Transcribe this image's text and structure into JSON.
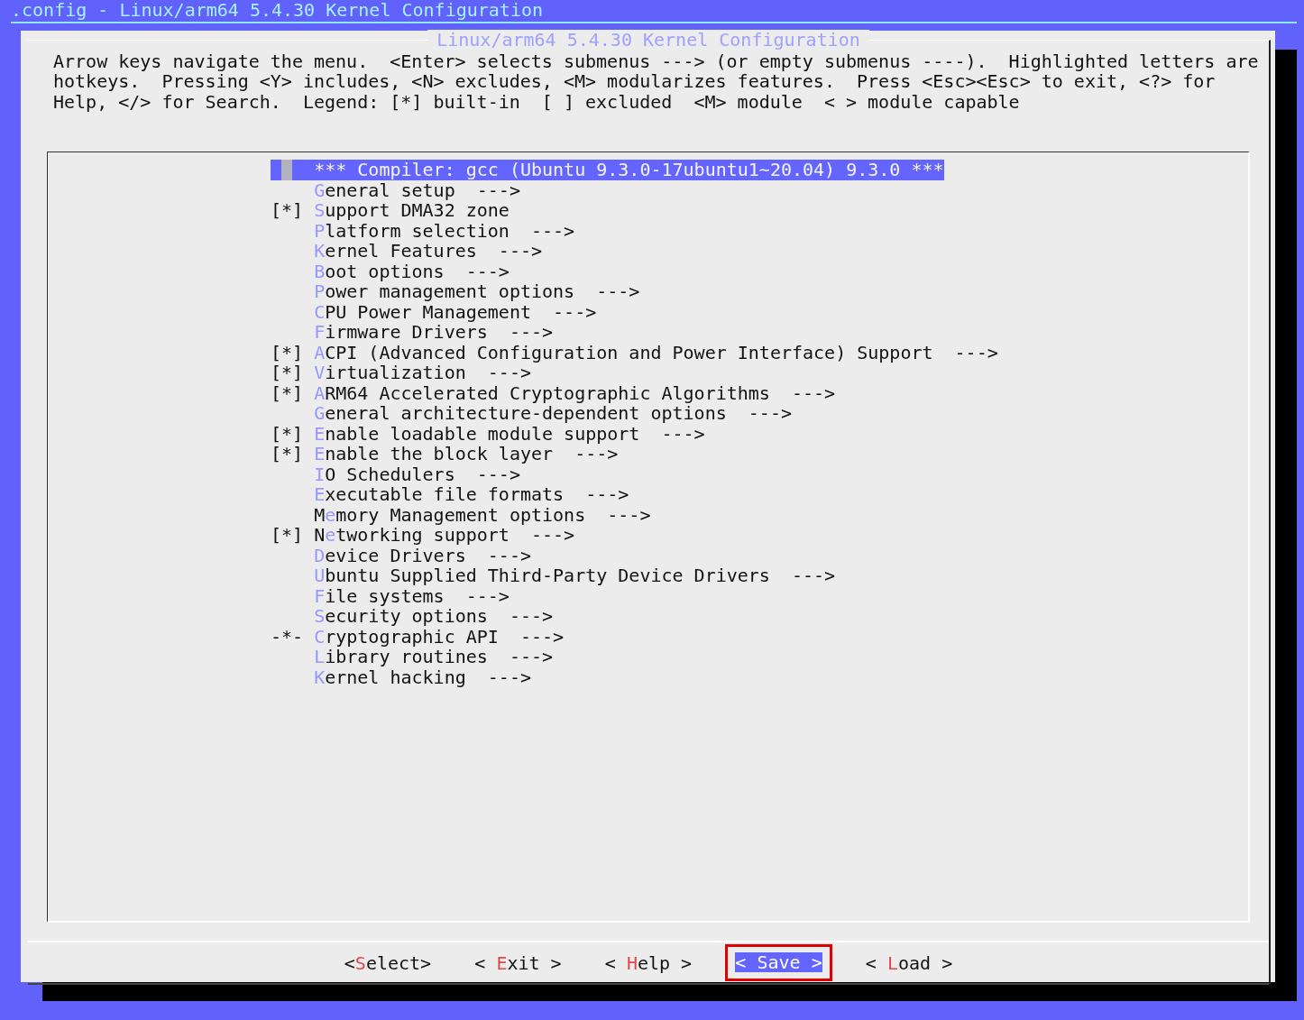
{
  "terminal_title": ".config - Linux/arm64 5.4.30 Kernel Configuration",
  "dialog": {
    "title": "Linux/arm64 5.4.30 Kernel Configuration",
    "help_text": "Arrow keys navigate the menu.  <Enter> selects submenus ---> (or empty submenus ----).  Highlighted letters are hotkeys.  Pressing <Y> includes, <N> excludes, <M> modularizes features.  Press <Esc><Esc> to exit, <?> for Help, </> for Search.  Legend: [*] built-in  [ ] excluded  <M> module  < > module capable",
    "menu_items": [
      {
        "lead": "*** Compiler: gcc (Ubuntu 9.3.0-17ubuntu1~20.04) 9.3.0 ***",
        "selected": true
      },
      {
        "hotkey": "G",
        "rest": "eneral setup  --->",
        "selected": false
      },
      {
        "marker": "[*]",
        "hotkey": "S",
        "rest": "upport DMA32 zone",
        "selected": false
      },
      {
        "hotkey": "P",
        "rest": "latform selection  --->",
        "selected": false
      },
      {
        "hotkey": "K",
        "rest": "ernel Features  --->",
        "selected": false
      },
      {
        "hotkey": "B",
        "rest": "oot options  --->",
        "selected": false
      },
      {
        "hotkey": "P",
        "rest": "ower management options  --->",
        "selected": false
      },
      {
        "hotkey": "C",
        "rest": "PU Power Management  --->",
        "selected": false
      },
      {
        "hotkey": "F",
        "rest": "irmware Drivers  --->",
        "selected": false
      },
      {
        "marker": "[*]",
        "hotkey": "A",
        "rest": "CPI (Advanced Configuration and Power Interface) Support  --->",
        "selected": false
      },
      {
        "marker": "[*]",
        "hotkey": "V",
        "rest": "irtualization  --->",
        "selected": false
      },
      {
        "marker": "[*]",
        "hotkey": "A",
        "rest": "RM64 Accelerated Cryptographic Algorithms  --->",
        "selected": false
      },
      {
        "hotkey": "G",
        "rest": "eneral architecture-dependent options  --->",
        "selected": false
      },
      {
        "marker": "[*]",
        "hotkey": "E",
        "rest": "nable loadable module support  --->",
        "selected": false
      },
      {
        "marker": "[*]",
        "hotkey": "E",
        "rest": "nable the block layer  --->",
        "selected": false
      },
      {
        "hotkey": "I",
        "rest": "O Schedulers  --->",
        "selected": false
      },
      {
        "hotkey": "E",
        "rest": "xecutable file formats  --->",
        "selected": false
      },
      {
        "lead": "M",
        "hotkey": "e",
        "rest": "mory Management options  --->",
        "selected": false
      },
      {
        "marker": "[*]",
        "lead": "N",
        "hotkey": "e",
        "rest": "tworking support  --->",
        "selected": false
      },
      {
        "hotkey": "D",
        "rest": "evice Drivers  --->",
        "selected": false
      },
      {
        "hotkey": "U",
        "rest": "buntu Supplied Third-Party Device Drivers  --->",
        "selected": false
      },
      {
        "hotkey": "F",
        "rest": "ile systems  --->",
        "selected": false
      },
      {
        "hotkey": "S",
        "rest": "ecurity options  --->",
        "selected": false
      },
      {
        "marker": "-*-",
        "hotkey": "C",
        "rest": "ryptographic API  --->",
        "selected": false
      },
      {
        "hotkey": "L",
        "rest": "ibrary routines  --->",
        "selected": false
      },
      {
        "hotkey": "K",
        "rest": "ernel hacking  --->",
        "selected": false
      }
    ],
    "buttons": [
      {
        "lead": "<",
        "hotkey": "S",
        "rest": "elect>",
        "selected": false,
        "annotated": false
      },
      {
        "lead": "< ",
        "hotkey": "E",
        "rest": "xit >",
        "selected": false,
        "annotated": false
      },
      {
        "lead": "< ",
        "hotkey": "H",
        "rest": "elp >",
        "selected": false,
        "annotated": false
      },
      {
        "lead": "< ",
        "hotkey": "S",
        "rest": "ave >",
        "selected": true,
        "annotated": true
      },
      {
        "lead": "< ",
        "hotkey": "L",
        "rest": "oad >",
        "selected": false,
        "annotated": false
      }
    ]
  }
}
